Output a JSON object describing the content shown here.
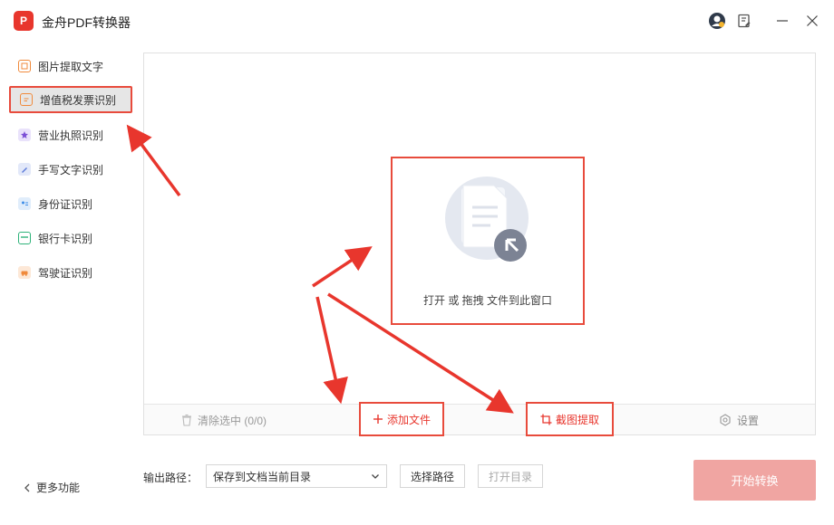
{
  "app": {
    "logo_text": "P",
    "title": "金舟PDF转换器"
  },
  "titlebar": {
    "icons": [
      "avatar-icon",
      "feedback-icon",
      "minimize-icon",
      "close-icon"
    ]
  },
  "sidebar": {
    "items": [
      {
        "label": "图片提取文字",
        "icon": "image-text-icon",
        "color": "#f08a3c",
        "active": false
      },
      {
        "label": "增值税发票识别",
        "icon": "invoice-icon",
        "color": "#f08a3c",
        "active": true
      },
      {
        "label": "营业执照识别",
        "icon": "license-icon",
        "color": "#7b4fd6",
        "active": false
      },
      {
        "label": "手写文字识别",
        "icon": "handwriting-icon",
        "color": "#5c7bd9",
        "active": false
      },
      {
        "label": "身份证识别",
        "icon": "id-card-icon",
        "color": "#3e8ee8",
        "active": false
      },
      {
        "label": "银行卡识别",
        "icon": "bank-card-icon",
        "color": "#2fb37a",
        "active": false
      },
      {
        "label": "驾驶证识别",
        "icon": "driver-license-icon",
        "color": "#f08a3c",
        "active": false
      }
    ],
    "more_label": "更多功能"
  },
  "main": {
    "drop_text": "打开 或 拖拽 文件到此窗口",
    "bottom_bar": {
      "clear_label": "清除选中 (0/0)",
      "add_label": "添加文件",
      "crop_label": "截图提取",
      "settings_label": "设置"
    }
  },
  "footer": {
    "output_label": "输出路径：",
    "output_value": "保存到文档当前目录",
    "choose_path_label": "选择路径",
    "open_dir_label": "打开目录",
    "start_label": "开始转换"
  },
  "colors": {
    "accent": "#e8362d",
    "highlight_border": "#e84b3c",
    "start_button": "#f0a5a2"
  }
}
